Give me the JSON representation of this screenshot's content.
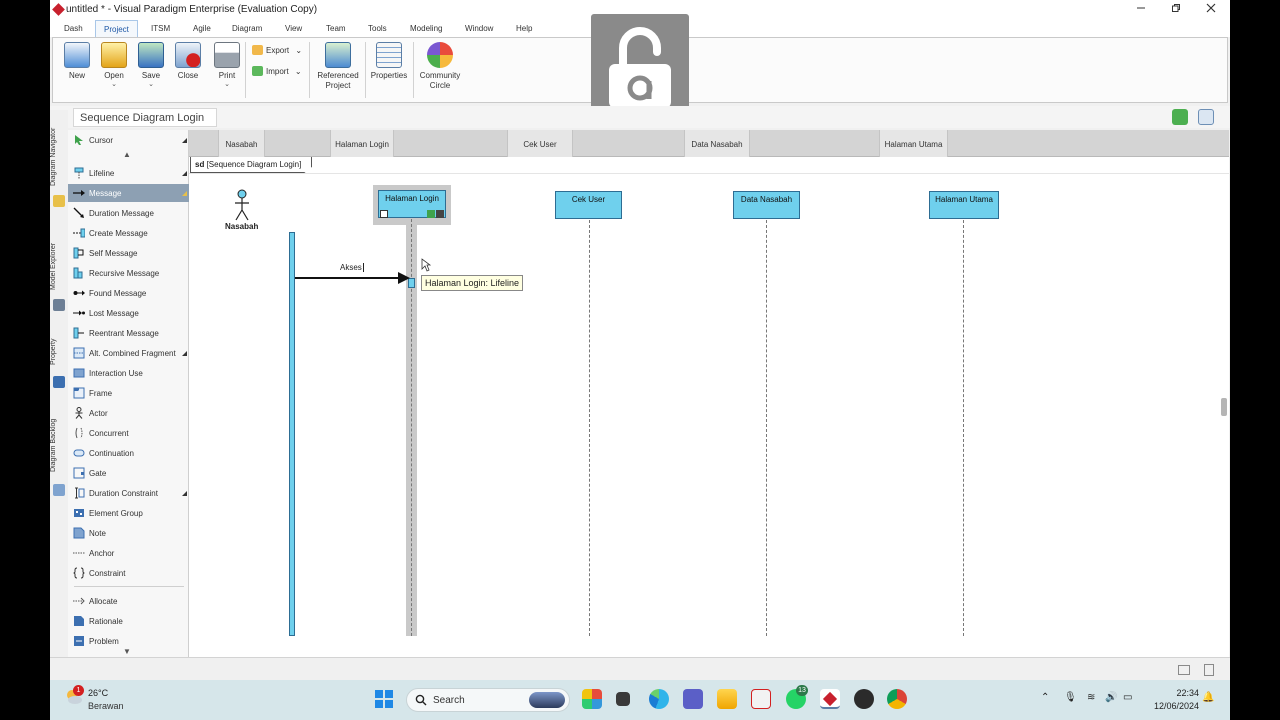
{
  "window": {
    "title": "untitled * - Visual Paradigm Enterprise (Evaluation Copy)"
  },
  "menu": [
    "Dash",
    "Project",
    "ITSM",
    "Agile",
    "Diagram",
    "View",
    "Team",
    "Tools",
    "Modeling",
    "Window",
    "Help"
  ],
  "menu_active": "Project",
  "ribbon": {
    "new": "New",
    "open": "Open",
    "save": "Save",
    "close": "Close",
    "print": "Print",
    "export": "Export",
    "import": "Import",
    "referenced_project_1": "Referenced",
    "referenced_project_2": "Project",
    "properties": "Properties",
    "community_1": "Community",
    "community_2": "Circle",
    "dropdown_arrow": "⌄"
  },
  "breadcrumb": "Sequence Diagram Login",
  "side_tabs": [
    "Diagram Navigator",
    "Model Explorer",
    "Property",
    "Diagram Backlog"
  ],
  "palette": [
    "Cursor",
    "Lifeline",
    "Message",
    "Duration Message",
    "Create Message",
    "Self Message",
    "Recursive Message",
    "Found Message",
    "Lost Message",
    "Reentrant Message",
    "Alt. Combined Fragment",
    "Interaction Use",
    "Frame",
    "Actor",
    "Concurrent",
    "Continuation",
    "Gate",
    "Duration Constraint",
    "Element Group",
    "Note",
    "Anchor",
    "Constraint",
    "Allocate",
    "Rationale",
    "Problem"
  ],
  "palette_active": "Message",
  "lanes": [
    "Nasabah",
    "Halaman Login",
    "Cek User",
    "Data Nasabah",
    "Halaman Utama"
  ],
  "frame": {
    "keyword": "sd",
    "name": "[Sequence Diagram Login]"
  },
  "actor": "Nasabah",
  "lifelines": [
    "Halaman Login",
    "Cek User",
    "Data Nasabah",
    "Halaman Utama"
  ],
  "message": "Akses",
  "tooltip": "Halaman Login: Lifeline",
  "taskbar": {
    "temperature": "26°C",
    "weather": "Berawan",
    "weather_badge": "1",
    "search": "Search",
    "teams_badge": "13",
    "time": "22:34",
    "date": "12/06/2024"
  },
  "icons": {
    "app": "visual-paradigm-icon",
    "lock": "unlock-icon",
    "search": "search-icon",
    "windows": "windows-start-icon"
  },
  "colors": {
    "lifeline_fill": "#6fd0ed",
    "palette_active": "#8da0b3",
    "accent": "#1d57a6"
  }
}
